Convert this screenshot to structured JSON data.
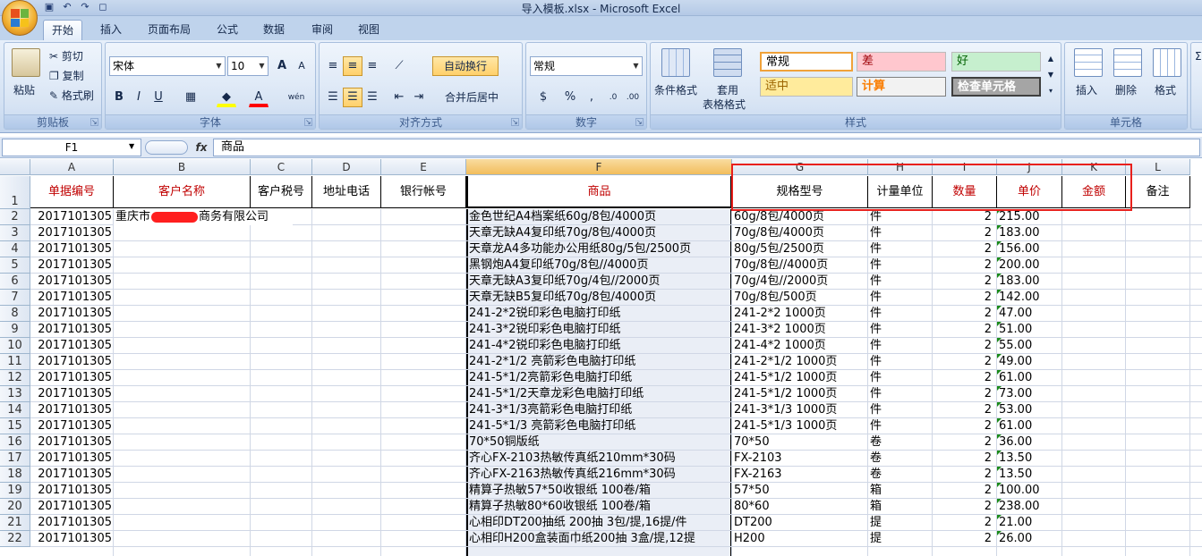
{
  "window": {
    "title": "导入模板.xlsx - Microsoft Excel"
  },
  "tabs": [
    "开始",
    "插入",
    "页面布局",
    "公式",
    "数据",
    "审阅",
    "视图"
  ],
  "clipboard": {
    "paste": "粘贴",
    "cut": "剪切",
    "copy": "复制",
    "format_painter": "格式刷",
    "label": "剪贴板"
  },
  "font": {
    "name": "宋体",
    "size": "10",
    "bold": "B",
    "italic": "I",
    "underline": "U",
    "grow": "A",
    "shrink": "A",
    "phonetic": "wén",
    "label": "字体"
  },
  "alignment": {
    "wrap": "自动换行",
    "merge": "合并后居中",
    "label": "对齐方式"
  },
  "number": {
    "format": "常规",
    "percent": "%",
    "comma": ",",
    "label": "数字"
  },
  "styles": {
    "conditional": "条件格式",
    "table_1": "套用",
    "table_2": "表格格式",
    "cells": [
      "常规",
      "差",
      "好",
      "适中",
      "计算",
      "检查单元格"
    ],
    "label": "样式"
  },
  "cells_group": {
    "insert": "插入",
    "delete": "删除",
    "format": "格式",
    "label": "单元格"
  },
  "formula_bar": {
    "name_box": "F1",
    "fx": "fx",
    "value": "商品"
  },
  "columns": [
    "A",
    "B",
    "C",
    "D",
    "E",
    "F",
    "G",
    "H",
    "I",
    "J",
    "K",
    "L"
  ],
  "headers": [
    "单据编号",
    "客户名称",
    "客户税号",
    "地址电话",
    "银行帐号",
    "商品",
    "规格型号",
    "计量单位",
    "数量",
    "单价",
    "金额",
    "备注"
  ],
  "rows": [
    {
      "id": "2017101305",
      "customer": "重庆市",
      "customer_tail": "商务有限公司",
      "product": "金色世纪A4档案纸60g/8包/4000页",
      "spec": "60g/8包/4000页",
      "unit": "件",
      "qty": "2",
      "price": "215.00"
    },
    {
      "id": "2017101305",
      "product": "天章无缺A4复印纸70g/8包/4000页",
      "spec": "70g/8包/4000页",
      "unit": "件",
      "qty": "2",
      "price": "183.00"
    },
    {
      "id": "2017101305",
      "product": "天章龙A4多功能办公用纸80g/5包/2500页",
      "spec": "80g/5包/2500页",
      "unit": "件",
      "qty": "2",
      "price": "156.00"
    },
    {
      "id": "2017101305",
      "product": "黑钢炮A4复印纸70g/8包//4000页",
      "spec": "70g/8包//4000页",
      "unit": "件",
      "qty": "2",
      "price": "200.00"
    },
    {
      "id": "2017101305",
      "product": "天章无缺A3复印纸70g/4包//2000页",
      "spec": "70g/4包//2000页",
      "unit": "件",
      "qty": "2",
      "price": "183.00"
    },
    {
      "id": "2017101305",
      "product": "天章无缺B5复印纸70g/8包/4000页",
      "spec": "70g/8包/500页",
      "unit": "件",
      "qty": "2",
      "price": "142.00"
    },
    {
      "id": "2017101305",
      "product": "241-2*2锐印彩色电脑打印纸",
      "spec": "241-2*2 1000页",
      "unit": "件",
      "qty": "2",
      "price": "47.00"
    },
    {
      "id": "2017101305",
      "product": "241-3*2锐印彩色电脑打印纸",
      "spec": "241-3*2 1000页",
      "unit": "件",
      "qty": "2",
      "price": "51.00"
    },
    {
      "id": "2017101305",
      "product": "241-4*2锐印彩色电脑打印纸",
      "spec": "241-4*2 1000页",
      "unit": "件",
      "qty": "2",
      "price": "55.00"
    },
    {
      "id": "2017101305",
      "product": "241-2*1/2 亮箭彩色电脑打印纸",
      "spec": "241-2*1/2 1000页",
      "unit": "件",
      "qty": "2",
      "price": "49.00"
    },
    {
      "id": "2017101305",
      "product": "241-5*1/2亮箭彩色电脑打印纸",
      "spec": "241-5*1/2 1000页",
      "unit": "件",
      "qty": "2",
      "price": "61.00"
    },
    {
      "id": "2017101305",
      "product": "241-5*1/2天章龙彩色电脑打印纸",
      "spec": "241-5*1/2 1000页",
      "unit": "件",
      "qty": "2",
      "price": "73.00"
    },
    {
      "id": "2017101305",
      "product": "241-3*1/3亮箭彩色电脑打印纸",
      "spec": "241-3*1/3 1000页",
      "unit": "件",
      "qty": "2",
      "price": "53.00"
    },
    {
      "id": "2017101305",
      "product": "241-5*1/3 亮箭彩色电脑打印纸",
      "spec": "241-5*1/3 1000页",
      "unit": "件",
      "qty": "2",
      "price": "61.00"
    },
    {
      "id": "2017101305",
      "product": "70*50铜版纸",
      "spec": "70*50",
      "unit": "卷",
      "qty": "2",
      "price": "36.00"
    },
    {
      "id": "2017101305",
      "product": "齐心FX-2103热敏传真纸210mm*30码",
      "spec": "FX-2103",
      "unit": "卷",
      "qty": "2",
      "price": "13.50"
    },
    {
      "id": "2017101305",
      "product": "齐心FX-2163热敏传真纸216mm*30码",
      "spec": "FX-2163",
      "unit": "卷",
      "qty": "2",
      "price": "13.50"
    },
    {
      "id": "2017101305",
      "product": "精算子热敏57*50收银纸 100卷/箱",
      "spec": "57*50",
      "unit": "箱",
      "qty": "2",
      "price": "100.00"
    },
    {
      "id": "2017101305",
      "product": "精算子热敏80*60收银纸 100卷/箱",
      "spec": "80*60",
      "unit": "箱",
      "qty": "2",
      "price": "238.00"
    },
    {
      "id": "2017101305",
      "product": "心相印DT200抽纸 200抽 3包/提,16提/件",
      "spec": "DT200",
      "unit": "提",
      "qty": "2",
      "price": "21.00"
    },
    {
      "id": "2017101305",
      "product": "心相印H200盒装面巾纸200抽 3盒/提,12提",
      "spec": "H200",
      "unit": "提",
      "qty": "2",
      "price": "26.00"
    }
  ],
  "colors": {
    "header_red": "#c00000",
    "highlight_box": "#e8201c",
    "redaction": "#ff1f1f"
  }
}
